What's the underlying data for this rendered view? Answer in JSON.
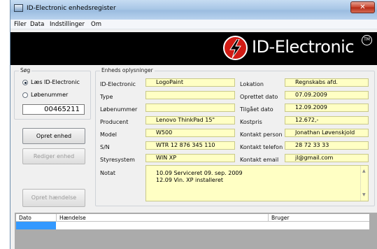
{
  "window": {
    "title": "ID-Electronic enhedsregister",
    "close_glyph": "✕"
  },
  "menu": [
    "Filer",
    "Data",
    "Indstillinger",
    "Om"
  ],
  "banner": {
    "brand": "ID-Electronic",
    "tm": "TM",
    "logo_icon": "lightning-bolt-icon",
    "colors": {
      "background": "#000000",
      "logo": "#d11b14"
    }
  },
  "search": {
    "group_label": "Søg",
    "options": [
      {
        "label": "Læs ID-Electronic",
        "checked": true
      },
      {
        "label": "Løbenummer",
        "checked": false
      }
    ],
    "value": "00465211"
  },
  "buttons": {
    "create_unit": "Opret enhed",
    "edit_unit": "Rediger enhed",
    "create_event": "Opret hændelse"
  },
  "unit_info": {
    "group_label": "Enheds oplysninger",
    "left_fields": [
      {
        "label": "ID-Electronic",
        "value": "LogoPaint"
      },
      {
        "label": "Type",
        "value": ""
      },
      {
        "label": "Løbenummer",
        "value": ""
      },
      {
        "label": "Producent",
        "value": "Lenovo ThinkPad 15\""
      },
      {
        "label": "Model",
        "value": "W500"
      },
      {
        "label": "S/N",
        "value": "WTR 12 876 345 110"
      },
      {
        "label": "Styresystem",
        "value": "WIN XP"
      }
    ],
    "right_fields": [
      {
        "label": "Lokation",
        "value": "Regnskabs afd."
      },
      {
        "label": "Oprettet dato",
        "value": "07.09.2009"
      },
      {
        "label": "Tilgået dato",
        "value": "12.09.2009"
      },
      {
        "label": "Kostpris",
        "value": "12.672,-"
      },
      {
        "label": "Kontakt person",
        "value": "Jonathan Løvenskjold"
      },
      {
        "label": "Kontakt telefon",
        "value": "28 72 33 33"
      },
      {
        "label": "Kontakt email",
        "value": "jl@gmail.com"
      }
    ],
    "notes_label": "Notat",
    "notes_lines": [
      "10.09  Serviceret 09. sep. 2009",
      "12.09  Vin. XP installeret"
    ]
  },
  "events_table": {
    "columns": [
      "Dato",
      "Hændelse",
      "Bruger"
    ]
  }
}
